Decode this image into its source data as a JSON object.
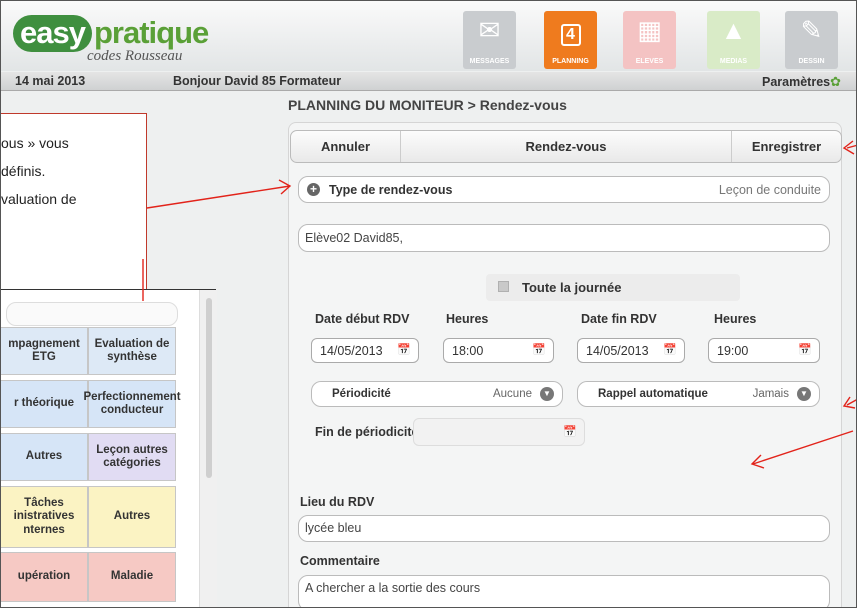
{
  "header": {
    "logo_main_easy": "easy",
    "logo_main_pratique": "pratique",
    "logo_sub": "codes Rousseau",
    "nav": [
      {
        "label": "MESSAGES",
        "icon": "envelope-icon"
      },
      {
        "label": "PLANNING",
        "icon": "calendar-icon",
        "badge": "4"
      },
      {
        "label": "ELEVES",
        "icon": "students-icon"
      },
      {
        "label": "MEDIAS",
        "icon": "image-icon"
      },
      {
        "label": "DESSIN",
        "icon": "pencil-icon"
      }
    ]
  },
  "infobar": {
    "date": "14 mai 2013",
    "greeting": "Bonjour David 85 Formateur",
    "settings": "Paramètres"
  },
  "page_title": "PLANNING DU MONITEUR > Rendez-vous",
  "toolbar": {
    "cancel": "Annuler",
    "title": "Rendez-vous",
    "save": "Enregistrer"
  },
  "form": {
    "type_label": "Type de rendez-vous",
    "type_value": "Leçon de conduite",
    "student": "Elève02 David85,",
    "all_day": "Toute la journée",
    "start_date_label": "Date début RDV",
    "start_hour_label": "Heures",
    "end_date_label": "Date fin RDV",
    "end_hour_label": "Heures",
    "start_date": "14/05/2013",
    "start_hour": "18:00",
    "end_date": "14/05/2013",
    "end_hour": "19:00",
    "periodicity_label": "Périodicité",
    "periodicity_value": "Aucune",
    "reminder_label": "Rappel automatique",
    "reminder_value": "Jamais",
    "period_end_label": "Fin de périodicité :",
    "place_label": "Lieu du RDV",
    "place_value": "lycée bleu",
    "comment_label": "Commentaire",
    "comment_value": "A chercher a la sortie des cours"
  },
  "callout": {
    "lines": [
      "ous » vous",
      "définis.",
      "valuation de"
    ]
  },
  "categories": [
    {
      "label": "mpagnement ETG",
      "color": "#dde9f6"
    },
    {
      "label": "Evaluation de synthèse",
      "color": "#dde9f6"
    },
    {
      "label": "r théorique",
      "color": "#d6e5f7"
    },
    {
      "label": "Perfectionnement conducteur",
      "color": "#d6e5f7"
    },
    {
      "label": "Autres",
      "color": "#d6e5f7"
    },
    {
      "label": "Leçon autres catégories",
      "color": "#e1dcf3"
    },
    {
      "label": "Tâches inistratives nternes",
      "color": "#fbf3c3"
    },
    {
      "label": "Autres",
      "color": "#fbf3c3"
    },
    {
      "label": "upération",
      "color": "#f6c9c4"
    },
    {
      "label": "Maladie",
      "color": "#f6c9c4"
    }
  ]
}
